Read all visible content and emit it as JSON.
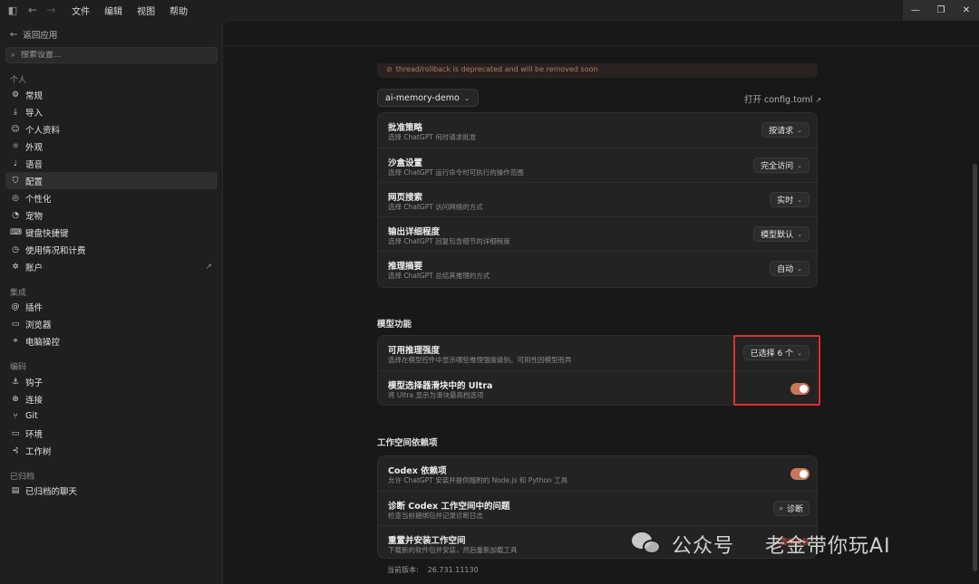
{
  "menu": [
    "文件",
    "编辑",
    "视图",
    "帮助"
  ],
  "sidebar": {
    "back_label": "返回应用",
    "search_placeholder": "搜索设置...",
    "sections": {
      "personal": "个人",
      "integrations": "集成",
      "coding": "编码",
      "archived": "已归档"
    },
    "items": [
      {
        "label": "常规",
        "icon": "gear-icon"
      },
      {
        "label": "导入",
        "icon": "import-icon"
      },
      {
        "label": "个人资料",
        "icon": "person-icon"
      },
      {
        "label": "外观",
        "icon": "sun-icon"
      },
      {
        "label": "语音",
        "icon": "mic-icon"
      },
      {
        "label": "配置",
        "icon": "shield-icon",
        "active": true
      },
      {
        "label": "个性化",
        "icon": "palette-icon"
      },
      {
        "label": "宠物",
        "icon": "pet-icon"
      },
      {
        "label": "键盘快捷键",
        "icon": "keyboard-icon"
      },
      {
        "label": "使用情况和计费",
        "icon": "gauge-icon"
      },
      {
        "label": "账户",
        "icon": "settings-icon",
        "external": true
      },
      {
        "label": "插件",
        "icon": "plugin-icon"
      },
      {
        "label": "浏览器",
        "icon": "browser-icon"
      },
      {
        "label": "电脑操控",
        "icon": "cursor-icon"
      },
      {
        "label": "钩子",
        "icon": "hook-icon"
      },
      {
        "label": "连接",
        "icon": "globe-icon"
      },
      {
        "label": "Git",
        "icon": "git-icon"
      },
      {
        "label": "环境",
        "icon": "monitor-icon"
      },
      {
        "label": "工作树",
        "icon": "tree-icon"
      },
      {
        "label": "已归档的聊天",
        "icon": "archive-icon"
      }
    ]
  },
  "main": {
    "warning": "thread/rollback is deprecated and will be removed soon",
    "project": "ai-memory-demo",
    "open_config": "打开 config.toml",
    "settings_rows": [
      {
        "title": "批准策略",
        "desc": "选择 ChatGPT 何时请求批准",
        "value": "按请求"
      },
      {
        "title": "沙盒设置",
        "desc": "选择 ChatGPT 运行命令时可执行的操作范围",
        "value": "完全访问"
      },
      {
        "title": "网页搜索",
        "desc": "选择 ChatGPT 访问网络的方式",
        "value": "实时"
      },
      {
        "title": "输出详细程度",
        "desc": "选择 ChatGPT 回复包含细节的详细程度",
        "value": "模型默认"
      },
      {
        "title": "推理摘要",
        "desc": "选择 ChatGPT 总结其推理的方式",
        "value": "自动"
      }
    ],
    "model_heading": "模型功能",
    "model_rows": [
      {
        "title": "可用推理强度",
        "desc": "选择在模型控件中显示哪些推理强度级别。可用性因模型而异",
        "value": "已选择 6 个"
      },
      {
        "title": "模型选择器滑块中的 Ultra",
        "desc": "将 Ultra 显示为滑块最高档选项",
        "toggle": true
      }
    ],
    "workspace_heading": "工作空间依赖项",
    "workspace_rows": [
      {
        "title": "Codex 依赖项",
        "desc": "允许 ChatGPT 安装并提供随附的 Node.js 和 Python 工具",
        "toggle": true
      },
      {
        "title": "诊断 Codex 工作空间中的问题",
        "desc": "检查当前捆绑包并记录诊断日志",
        "button": "诊断"
      },
      {
        "title": "重置并安装工作空间",
        "desc": "下载新的软件包并安装，然后重新加载工具",
        "button": "重新安装"
      }
    ],
    "version_label": "当前版本:",
    "version_value": "26.731.11130"
  },
  "watermark": {
    "left": "公众号",
    "right": "老金带你玩AI"
  },
  "colors": {
    "accent": "#c8785a",
    "highlight": "#e0302e"
  }
}
